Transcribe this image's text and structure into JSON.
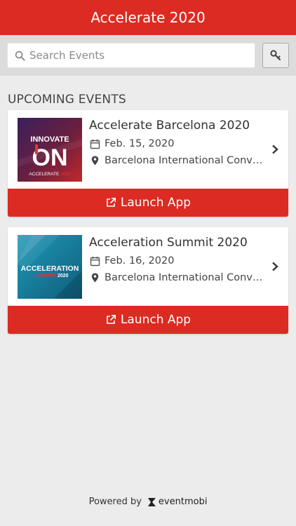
{
  "header": {
    "title": "Accelerate 2020"
  },
  "search": {
    "placeholder": "Search Events"
  },
  "section": {
    "title": "UPCOMING EVENTS"
  },
  "events": [
    {
      "name": "Accelerate Barcelona 2020",
      "date": "Feb. 15, 2020",
      "location": "Barcelona International Convention Centre",
      "launch_label": "Launch App",
      "thumb": {
        "line1": "INNOVATE",
        "big": "ON",
        "line3": "ACCELERATE",
        "year": "2020"
      }
    },
    {
      "name": "Acceleration Summit 2020",
      "date": "Feb. 16, 2020",
      "location": "Barcelona International Convention Centre",
      "launch_label": "Launch App",
      "thumb": {
        "line1": "ACCELERATION",
        "line2": "SUMMIT",
        "year": "2020"
      }
    }
  ],
  "footer": {
    "powered_by": "Powered by",
    "brand": "eventmobi"
  },
  "colors": {
    "brand_red": "#dc2b22",
    "background": "#ececec"
  }
}
